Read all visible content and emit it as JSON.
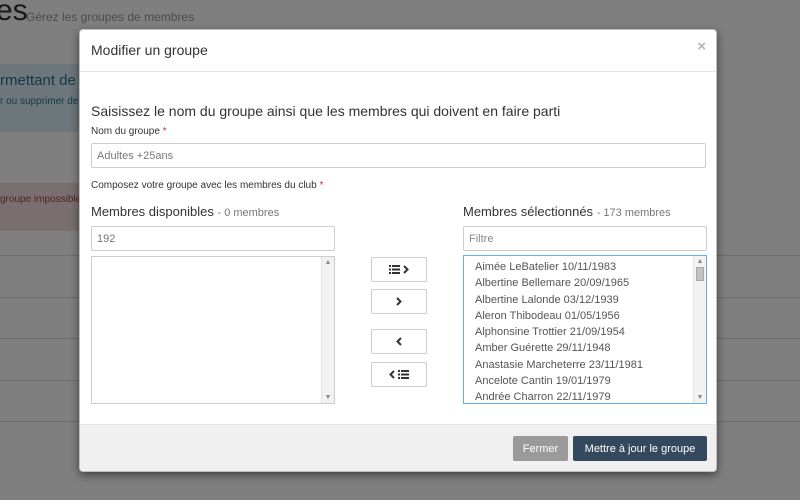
{
  "background": {
    "title": "es",
    "subtitle": "Gérez les groupes de membres",
    "info_title": "rmettant de c",
    "info_text": "r ou supprimer de",
    "danger_text": "groupe impossible d"
  },
  "modal": {
    "title": "Modifier un groupe",
    "close_label": "×",
    "lead": "Saisissez le nom du groupe ainsi que les membres qui doivent en faire parti",
    "name_label": "Nom du groupe",
    "name_value": "Adultes +25ans",
    "compose_label": "Composez votre groupe avec les membres du club",
    "required_mark": "*",
    "available": {
      "title": "Membres disponibles",
      "count": "- 0 membres",
      "filter_value": "192",
      "items": []
    },
    "selected": {
      "title": "Membres sélectionnés",
      "count": "- 173 membres",
      "filter_placeholder": "Filtre",
      "items": [
        "Aimée LeBatelier 10/11/1983",
        "Albertine Bellemare 20/09/1965",
        "Albertine Lalonde 03/12/1939",
        "Aleron Thibodeau 01/05/1956",
        "Alphonsine Trottier 21/09/1954",
        "Amber Guérette 29/11/1948",
        "Anastasie Marcheterre 23/11/1981",
        "Ancelote Cantin 19/01/1979",
        "Andrée Charron 22/11/1979"
      ]
    },
    "buttons": {
      "move_all_right_icon": "list-chevron-right-icon",
      "move_right_icon": "chevron-right-icon",
      "move_left_icon": "chevron-left-icon",
      "move_all_left_icon": "chevron-left-list-icon"
    },
    "footer": {
      "close_label": "Fermer",
      "submit_label": "Mettre à jour le groupe"
    }
  },
  "colors": {
    "primary": "#34495e",
    "secondary": "#9a9a9a",
    "required": "#c9302c"
  }
}
